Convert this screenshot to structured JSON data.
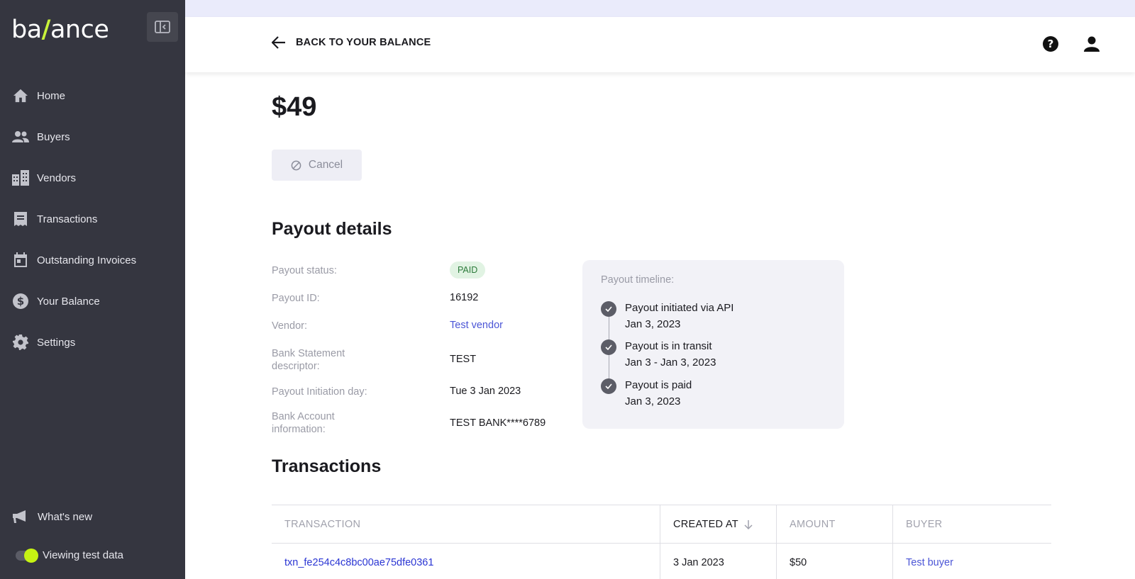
{
  "sidebar": {
    "logo": {
      "pre": "ba",
      "slash": "/",
      "post": "ance"
    },
    "items": [
      {
        "label": "Home",
        "icon": "home-icon"
      },
      {
        "label": "Buyers",
        "icon": "people-icon"
      },
      {
        "label": "Vendors",
        "icon": "building-icon"
      },
      {
        "label": "Transactions",
        "icon": "receipt-icon"
      },
      {
        "label": "Outstanding Invoices",
        "icon": "calendar-icon"
      },
      {
        "label": "Your Balance",
        "icon": "dollar-circle-icon"
      },
      {
        "label": "Settings",
        "icon": "gear-icon"
      }
    ],
    "whats_new": "What's new",
    "test_data_label": "Viewing test data",
    "test_data_on": true
  },
  "header": {
    "back_label": "BACK TO YOUR BALANCE"
  },
  "main": {
    "amount": "$49",
    "cancel_label": "Cancel",
    "details_title": "Payout details",
    "details": {
      "status_label": "Payout status:",
      "status_value": "PAID",
      "id_label": "Payout ID:",
      "id_value": "16192",
      "vendor_label": "Vendor:",
      "vendor_value": "Test vendor",
      "descriptor_label_1": "Bank Statement",
      "descriptor_label_2": "descriptor:",
      "descriptor_value": "TEST",
      "initiation_label": "Payout Initiation day:",
      "initiation_value": "Tue 3 Jan 2023",
      "bank_label_1": "Bank Account",
      "bank_label_2": "information:",
      "bank_value": "TEST BANK****6789"
    },
    "timeline": {
      "title": "Payout timeline:",
      "steps": [
        {
          "title": "Payout initiated via API",
          "date": "Jan 3, 2023"
        },
        {
          "title": "Payout is in transit",
          "date": "Jan 3 - Jan 3, 2023"
        },
        {
          "title": "Payout is paid",
          "date": "Jan 3, 2023"
        }
      ]
    },
    "transactions_title": "Transactions",
    "table": {
      "headers": [
        "TRANSACTION",
        "CREATED AT",
        "AMOUNT",
        "BUYER"
      ],
      "rows": [
        {
          "transaction": "txn_fe254c4c8bc00ae75dfe0361",
          "created_at": "3 Jan 2023",
          "amount": "$50",
          "buyer": "Test buyer"
        }
      ]
    }
  },
  "colors": {
    "sidebar_bg": "#353640",
    "accent_lime": "#c6f313",
    "link": "#4b55d6",
    "badge_bg": "#e1f3e3",
    "badge_text": "#2b7a3a"
  }
}
